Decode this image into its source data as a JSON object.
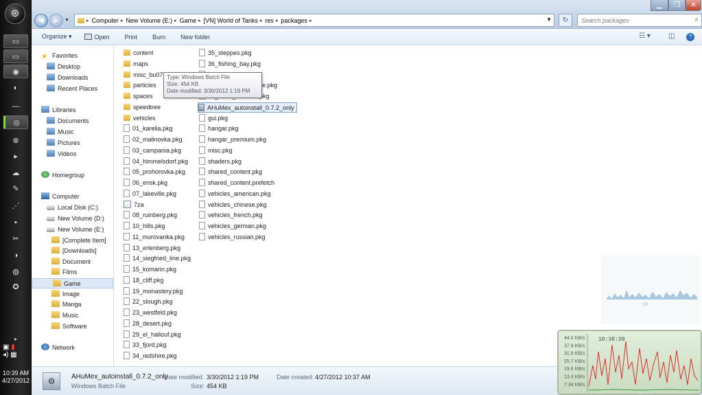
{
  "window": {
    "minimize": "▁",
    "maximize": "❐",
    "close": "✕"
  },
  "address": {
    "crumbs": [
      "Computer",
      "New Volume (E:)",
      "Game",
      "[VN] World of Tanks",
      "res",
      "packages"
    ]
  },
  "search": {
    "placeholder": "Search packages"
  },
  "toolbar": {
    "organize": "Organize ▾",
    "open": "Open",
    "print": "Print",
    "burn": "Burn",
    "new_folder": "New folder"
  },
  "nav": {
    "items": [
      {
        "label": "Favorites",
        "icon": "star-icon"
      },
      {
        "label": "Desktop",
        "icon": "desktop-icon"
      },
      {
        "label": "Downloads",
        "icon": "downloads-icon"
      },
      {
        "label": "Recent Places",
        "icon": "recent-places-icon"
      },
      {
        "label": "Libraries",
        "icon": "libraries-icon"
      },
      {
        "label": "Documents",
        "icon": "documents-icon"
      },
      {
        "label": "Music",
        "icon": "music-icon"
      },
      {
        "label": "Pictures",
        "icon": "pictures-icon"
      },
      {
        "label": "Videos",
        "icon": "videos-icon"
      },
      {
        "label": "Homegroup",
        "icon": "homegroup-icon"
      },
      {
        "label": "Computer",
        "icon": "computer-icon"
      },
      {
        "label": "Local Disk (C:)",
        "icon": "drive-icon"
      },
      {
        "label": "New Volume (D:)",
        "icon": "drive-icon"
      },
      {
        "label": "New Volume (E:)",
        "icon": "drive-icon"
      },
      {
        "label": "[Complete Item]",
        "icon": "folder-icon"
      },
      {
        "label": "[Downloads]",
        "icon": "folder-icon"
      },
      {
        "label": "Document",
        "icon": "folder-icon"
      },
      {
        "label": "Films",
        "icon": "folder-icon"
      },
      {
        "label": "Game",
        "icon": "folder-icon",
        "selected": true
      },
      {
        "label": "Image",
        "icon": "folder-icon"
      },
      {
        "label": "Manga",
        "icon": "folder-icon"
      },
      {
        "label": "Music",
        "icon": "folder-icon"
      },
      {
        "label": "Software",
        "icon": "folder-icon"
      },
      {
        "label": "Network",
        "icon": "network-icon"
      }
    ]
  },
  "files": {
    "col1": [
      {
        "name": "content",
        "type": "folder"
      },
      {
        "name": "maps",
        "type": "folder"
      },
      {
        "name": "misc_bu0711",
        "type": "folder"
      },
      {
        "name": "particles",
        "type": "folder"
      },
      {
        "name": "spaces",
        "type": "folder"
      },
      {
        "name": "speedtree",
        "type": "folder"
      },
      {
        "name": "vehicles",
        "type": "folder"
      },
      {
        "name": "01_karelia.pkg",
        "type": "doc"
      },
      {
        "name": "02_malinovka.pkg",
        "type": "doc"
      },
      {
        "name": "03_campania.pkg",
        "type": "doc"
      },
      {
        "name": "04_himmelsdorf.pkg",
        "type": "doc"
      },
      {
        "name": "05_prohorovka.pkg",
        "type": "doc"
      },
      {
        "name": "06_ensk.pkg",
        "type": "doc"
      },
      {
        "name": "07_lakeville.pkg",
        "type": "doc"
      },
      {
        "name": "7za",
        "type": "exe"
      },
      {
        "name": "08_ruinberg.pkg",
        "type": "doc"
      },
      {
        "name": "10_hills.pkg",
        "type": "doc"
      },
      {
        "name": "11_murovanka.pkg",
        "type": "doc"
      },
      {
        "name": "13_erlenberg.pkg",
        "type": "doc"
      },
      {
        "name": "14_siegfried_line.pkg",
        "type": "doc"
      },
      {
        "name": "15_komarin.pkg",
        "type": "doc"
      },
      {
        "name": "18_cliff.pkg",
        "type": "doc"
      },
      {
        "name": "19_monastery.pkg",
        "type": "doc"
      },
      {
        "name": "22_slough.pkg",
        "type": "doc"
      },
      {
        "name": "23_westfeld.pkg",
        "type": "doc"
      },
      {
        "name": "28_desert.pkg",
        "type": "doc"
      },
      {
        "name": "29_el_hallouf.pkg",
        "type": "doc"
      },
      {
        "name": "33_fjord.pkg",
        "type": "doc"
      },
      {
        "name": "34_redshire.pkg",
        "type": "doc"
      }
    ],
    "col2": [
      {
        "name": "35_steppes.pkg",
        "type": "doc"
      },
      {
        "name": "36_fishing_bay.pkg",
        "type": "doc"
      },
      {
        "name": "37_caucasus.pkg",
        "type": "doc"
      },
      {
        "name": "38_mannerheim_line.pkg",
        "type": "doc"
      },
      {
        "name": "44_north_america.pkg",
        "type": "doc"
      },
      {
        "name": "AHuMex_autoinstall_0.7.2_only",
        "type": "bat",
        "selected": true
      },
      {
        "name": "gui.pkg",
        "type": "doc"
      },
      {
        "name": "hangar.pkg",
        "type": "doc"
      },
      {
        "name": "hangar_premium.pkg",
        "type": "doc"
      },
      {
        "name": "misc.pkg",
        "type": "doc"
      },
      {
        "name": "shaders.pkg",
        "type": "doc"
      },
      {
        "name": "shared_content.pkg",
        "type": "doc"
      },
      {
        "name": "shared_content.prefetch",
        "type": "doc"
      },
      {
        "name": "vehicles_american.pkg",
        "type": "doc"
      },
      {
        "name": "vehicles_chinese.pkg",
        "type": "doc"
      },
      {
        "name": "vehicles_french.pkg",
        "type": "doc"
      },
      {
        "name": "vehicles_german.pkg",
        "type": "doc"
      },
      {
        "name": "vehicles_russian.pkg",
        "type": "doc"
      }
    ]
  },
  "tooltip": {
    "type": "Type: Windows Batch File",
    "size": "Size: 454 KB",
    "modified": "Date modified: 3/30/2012 1:19 PM"
  },
  "details": {
    "name": "AHuMex_autoinstall_0.7.2_only",
    "type": "Windows Batch File",
    "modified_label": "Date modified:",
    "modified": "3/30/2012 1:19 PM",
    "size_label": "Size:",
    "size": "454 KB",
    "created_label": "Date created:",
    "created": "4/27/2012 10:37 AM"
  },
  "dock": {
    "time": "10:39 AM",
    "date": "4/27/2012"
  },
  "gadget": {
    "time": "10:38:39",
    "labels": [
      "44.0 KB/s",
      "37.9 KB/s",
      "31.8 KB/s",
      "25.7 KB/s",
      "19.6 KB/s",
      "13.4 KB/s",
      "7.34 KB/s"
    ],
    "up_label": "UP"
  },
  "colors": {
    "accent": "#2b67a8",
    "selection": "#e5eefa",
    "graph": "#e02a2a"
  }
}
